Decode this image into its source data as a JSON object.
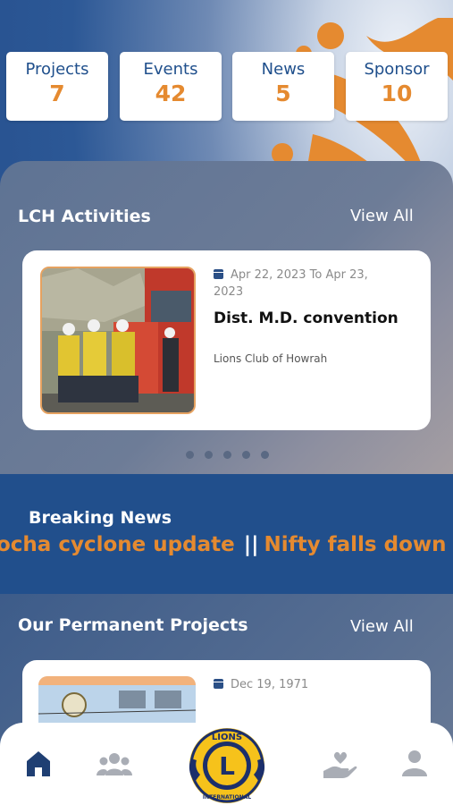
{
  "colors": {
    "primary": "#1f4f8c",
    "accent": "#e58a30",
    "nav_active": "#1f3f73",
    "nav_inactive": "#a9adb5"
  },
  "stats": [
    {
      "label": "Projects",
      "value": "7"
    },
    {
      "label": "Events",
      "value": "42"
    },
    {
      "label": "News",
      "value": "5"
    },
    {
      "label": "Sponsor",
      "value": "10"
    }
  ],
  "activities": {
    "title": "LCH Activities",
    "view_all": "View All",
    "card": {
      "date_line1": "Apr 22, 2023 To Apr 23,",
      "date_line2": "2023",
      "title": "Dist. M.D. convention",
      "club": "Lions Club of Howrah"
    },
    "dots_count": 5
  },
  "breaking_news": {
    "title": "Breaking News",
    "items": [
      "ocha cyclone update",
      "Nifty falls down"
    ],
    "separator": "||"
  },
  "projects": {
    "title": "Our Permanent Projects",
    "view_all": "View All",
    "card": {
      "date": "Dec 19, 1971"
    }
  },
  "nav": {
    "items": [
      {
        "icon": "home-icon",
        "active": true
      },
      {
        "icon": "members-icon",
        "active": false
      },
      {
        "icon": "lions-logo",
        "active": false
      },
      {
        "icon": "donate-icon",
        "active": false
      },
      {
        "icon": "profile-icon",
        "active": false
      }
    ],
    "logo_text_top": "LIONS",
    "logo_letter": "L",
    "logo_text_bottom": "INTERNATIONAL"
  }
}
